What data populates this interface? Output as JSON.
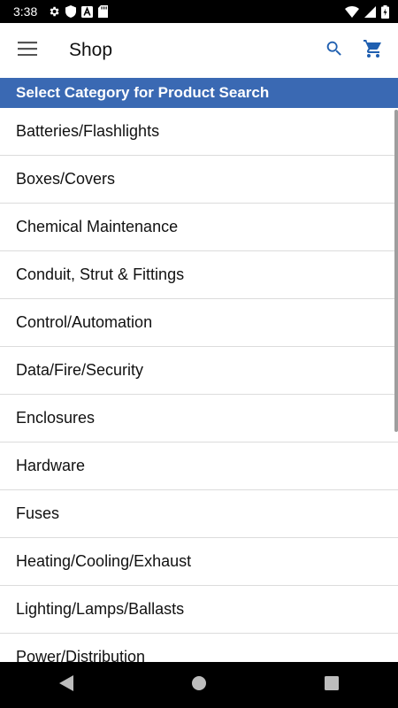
{
  "status_bar": {
    "time": "3:38",
    "left_icons": [
      "gear-icon",
      "shield-icon",
      "a-box-icon",
      "sd-card-icon"
    ],
    "right_icons": [
      "wifi-icon",
      "cell-signal-icon",
      "battery-charging-icon"
    ]
  },
  "app_bar": {
    "title": "Shop",
    "icons": [
      "menu-icon",
      "search-icon",
      "cart-icon"
    ]
  },
  "colors": {
    "header_bg": "#3a69b3",
    "action_icon": "#1f5fb0",
    "status_bar_bg": "#000000"
  },
  "category_header": "Select Category for Product Search",
  "categories": [
    "Batteries/Flashlights",
    "Boxes/Covers",
    "Chemical Maintenance",
    "Conduit, Strut & Fittings",
    "Control/Automation",
    "Data/Fire/Security",
    "Enclosures",
    "Hardware",
    "Fuses",
    "Heating/Cooling/Exhaust",
    "Lighting/Lamps/Ballasts",
    "Power/Distribution"
  ],
  "nav_bar": {
    "icons": [
      "back-icon",
      "home-icon",
      "recents-icon"
    ]
  }
}
